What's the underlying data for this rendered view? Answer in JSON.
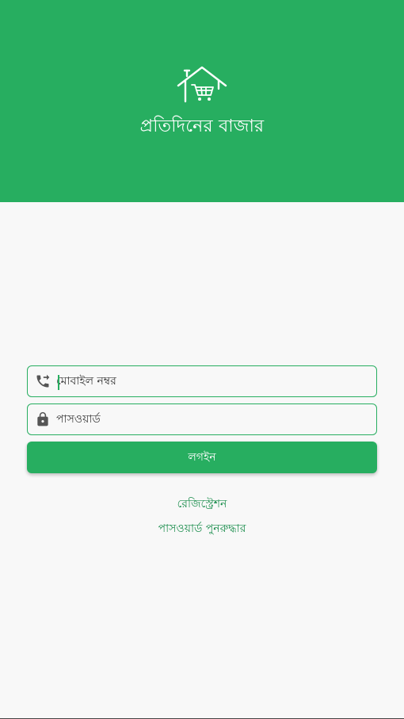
{
  "header": {
    "title": "প্রতিদিনের বাজার",
    "logo_icon": "house-cart-icon",
    "background_color": "#27ae60"
  },
  "form": {
    "phone": {
      "placeholder": "মোবাইল নম্বর",
      "value": "",
      "icon": "phone-forward-icon"
    },
    "password": {
      "placeholder": "পাসওয়ার্ড",
      "value": "",
      "icon": "lock-icon"
    },
    "login_label": "লগইন"
  },
  "links": {
    "register": "রেজিস্ট্রেশন",
    "recover_password": "পাসওয়ার্ড পুনরুদ্ধার"
  },
  "colors": {
    "accent": "#27ae60",
    "background": "#f8f8f8",
    "link": "#1e8f4f"
  }
}
